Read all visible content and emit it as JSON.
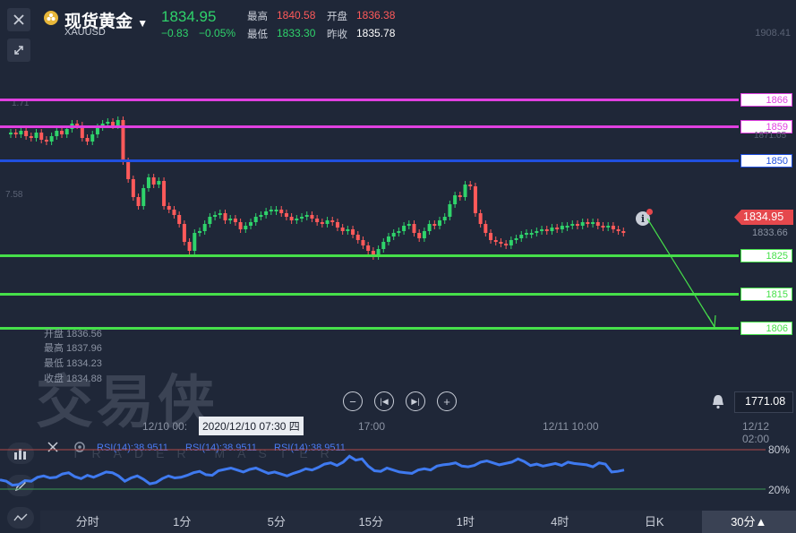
{
  "header": {
    "title": "现货黄金",
    "symbol": "XAUUSD",
    "price": "1834.95",
    "change": "−0.83",
    "change_pct": "−0.05%",
    "high_label": "最高",
    "high_value": "1840.58",
    "open_label": "开盘",
    "open_value": "1836.38",
    "low_label": "最低",
    "low_value": "1833.30",
    "prev_close_label": "昨收",
    "prev_close_value": "1835.78",
    "brand_color": "#e8b73a",
    "up_color": "#2fd36b",
    "down_color": "#ff5a5a"
  },
  "axis": {
    "top_value": "1908.41",
    "ghost_left_1": "1.71",
    "ghost_left_2": "7.58",
    "ghost_right_1": "1871.05",
    "current_price": "1834.95",
    "sub_price": "1833.66",
    "alert_price": "1771.08"
  },
  "levels": [
    {
      "label": "1866",
      "color": "#e040e0"
    },
    {
      "label": "1859",
      "color": "#e040e0"
    },
    {
      "label": "1850",
      "color": "#2050e0"
    },
    {
      "label": "1825",
      "color": "#46e04a"
    },
    {
      "label": "1815",
      "color": "#46e04a"
    },
    {
      "label": "1806",
      "color": "#46e04a"
    }
  ],
  "ohlc": {
    "open": "开盘 1836.56",
    "high": "最高 1837.96",
    "low": "最低 1834.23",
    "close": "收盘 1834.88"
  },
  "watermark": {
    "main": "交易侠",
    "sub": "TRADER MASTER"
  },
  "time_axis": {
    "t1": "12/10 00:",
    "cursor": "2020/12/10 07:30 四",
    "t2": "17:00",
    "t3": "12/11 10:00",
    "t4": "12/12 02:00"
  },
  "rsi": {
    "label1": "RSI(14):38.9511",
    "label2": "RSI(14):38.9511",
    "label3": "RSI(14):38.9511",
    "upper": "80%",
    "lower": "20%",
    "values": [
      34,
      32,
      26,
      27,
      33,
      32,
      38,
      40,
      37,
      38,
      43,
      45,
      39,
      36,
      41,
      38,
      42,
      46,
      45,
      40,
      32,
      37,
      40,
      35,
      28,
      30,
      36,
      40,
      37,
      38,
      41,
      45,
      47,
      42,
      41,
      48,
      50,
      52,
      49,
      46,
      50,
      52,
      48,
      44,
      46,
      43,
      40,
      44,
      47,
      51,
      49,
      53,
      58,
      60,
      56,
      61,
      70,
      64,
      66,
      55,
      48,
      47,
      52,
      49,
      46,
      45,
      44,
      49,
      51,
      49,
      55,
      57,
      58,
      60,
      55,
      54,
      56,
      61,
      63,
      60,
      57,
      59,
      61,
      66,
      62,
      56,
      58,
      55,
      57,
      59,
      56,
      61,
      59,
      58,
      57,
      54,
      60,
      58,
      46,
      47,
      49
    ]
  },
  "timeframes": [
    "分时",
    "1分",
    "5分",
    "15分",
    "1时",
    "4时",
    "日K",
    "30分▲"
  ],
  "active_timeframe": 7
}
